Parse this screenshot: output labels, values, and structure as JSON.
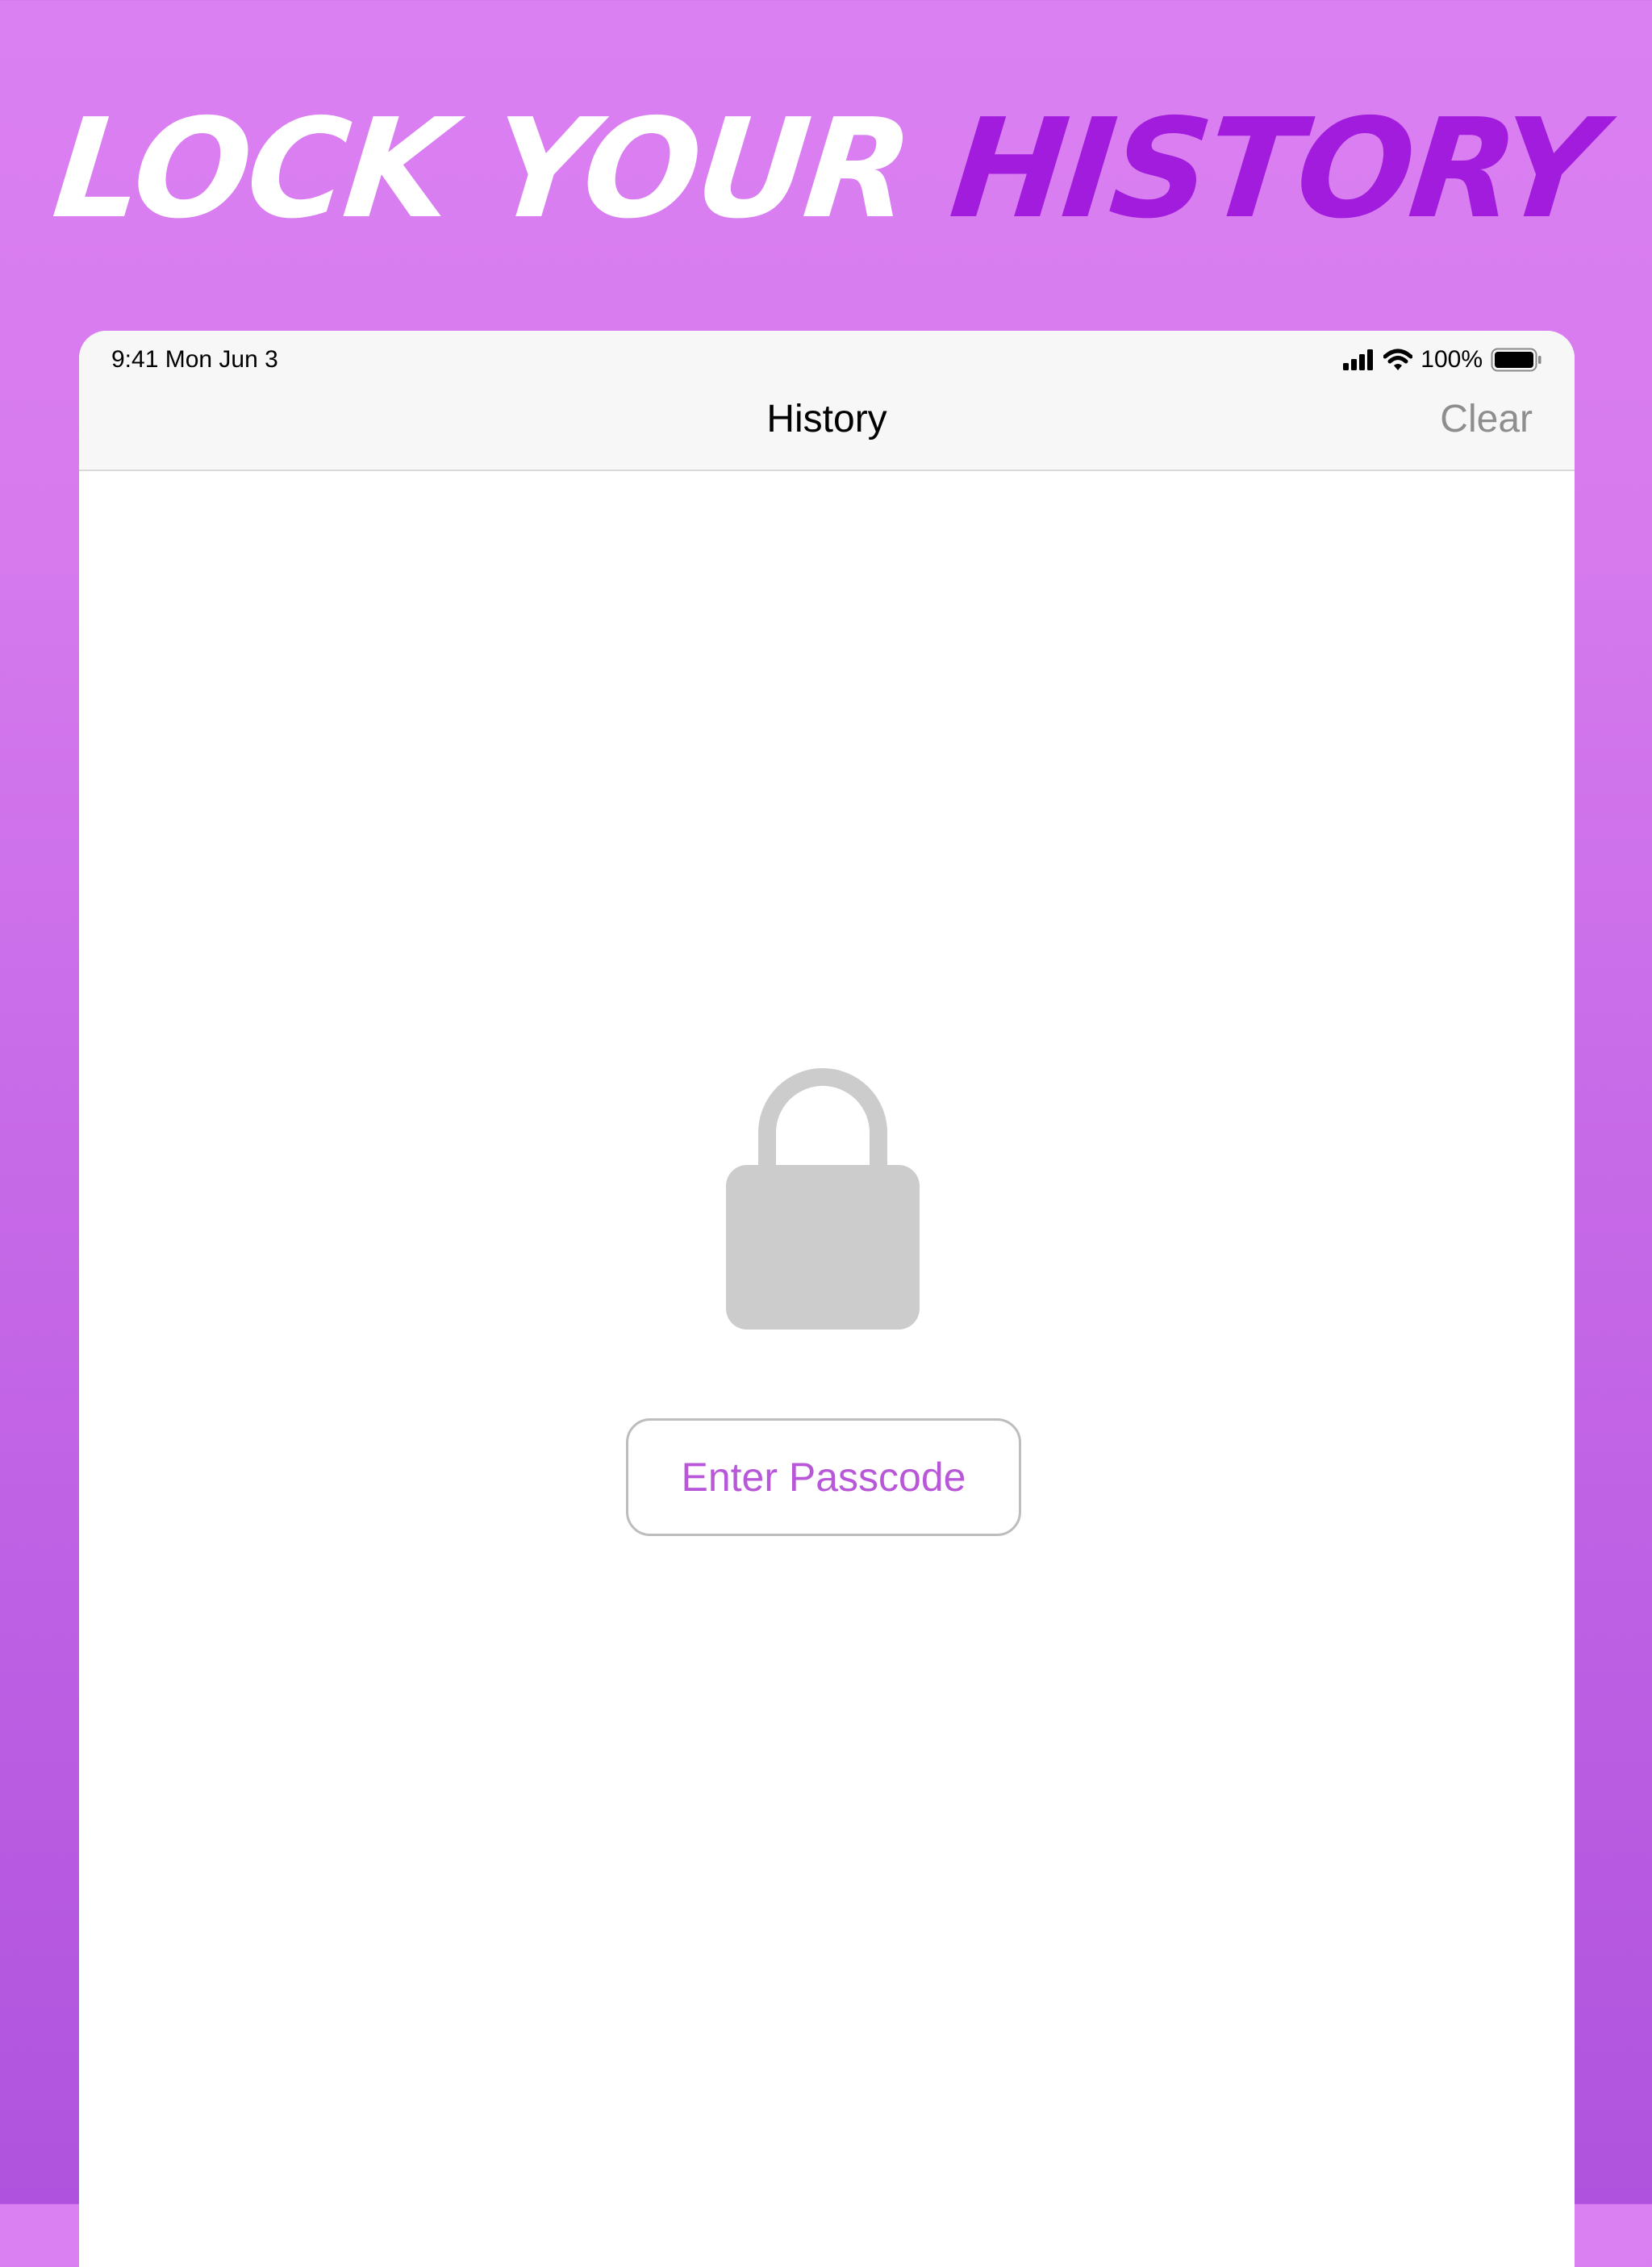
{
  "headline": {
    "part1": "LOCK YOUR",
    "part2": "HISTORY"
  },
  "status_bar": {
    "time": "9:41 Mon Jun 3",
    "battery_percent": "100%",
    "icons": [
      "signal-icon",
      "wifi-icon",
      "battery-icon"
    ]
  },
  "nav": {
    "title": "History",
    "clear_label": "Clear"
  },
  "lock_screen": {
    "icon": "lock-icon",
    "button_label": "Enter Passcode"
  },
  "colors": {
    "background_top": "#DB80F2",
    "background_bottom": "#AF53DE",
    "headline_accent": "#A21CDD",
    "button_text": "#B858D9",
    "lock_gray": "#CCCCCC",
    "clear_gray": "#8E8E8E"
  }
}
